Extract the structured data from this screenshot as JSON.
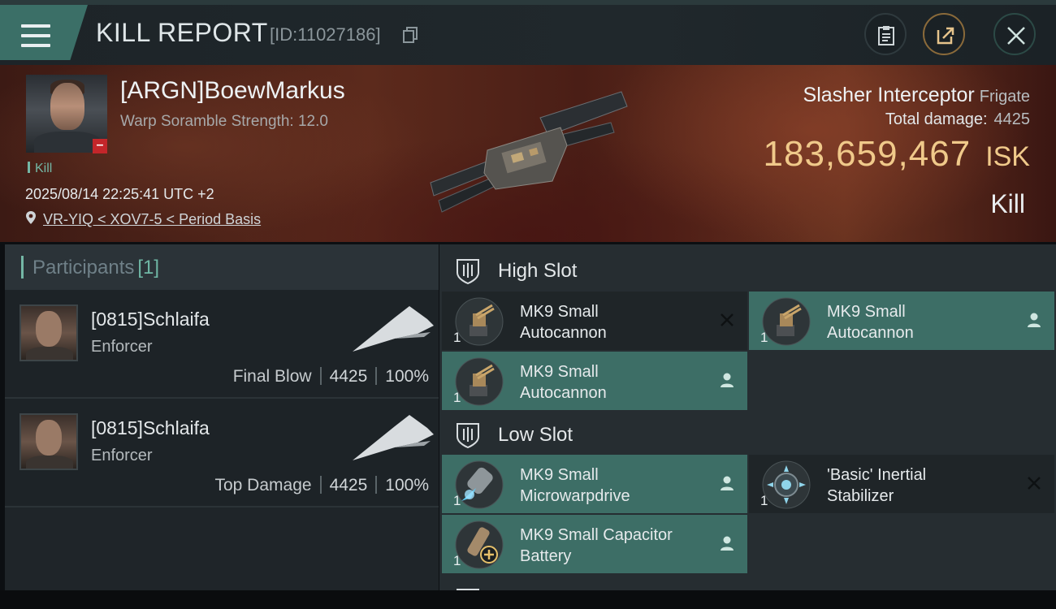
{
  "header": {
    "title": "KILL REPORT",
    "id_text": "[ID:11027186]"
  },
  "victim": {
    "name": "[ARGN]BoewMarkus",
    "warp_scramble": "Warp Soramble Strength: 12.0",
    "tag": "Kill",
    "datetime": "2025/08/14 22:25:41 UTC +2",
    "location": "VR-YIQ < XOV7-5 < Period Basis"
  },
  "ship": {
    "name": "Slasher Interceptor",
    "class": "Frigate",
    "damage_label": "Total damage:",
    "damage_value": "4425",
    "isk_value": "183,659,467",
    "isk_unit": "ISK",
    "result": "Kill"
  },
  "participants": {
    "title": "Participants",
    "count": "[1]",
    "rows": [
      {
        "name": "[0815]Schlaifa",
        "ship": "Enforcer",
        "label": "Final Blow",
        "damage": "4425",
        "percent": "100%"
      },
      {
        "name": "[0815]Schlaifa",
        "ship": "Enforcer",
        "label": "Top Damage",
        "damage": "4425",
        "percent": "100%"
      }
    ]
  },
  "slots": {
    "high": {
      "title": "High Slot",
      "modules": [
        {
          "qty": "1",
          "line1": "MK9 Small",
          "line2": "Autocannon",
          "state": "destroyed"
        },
        {
          "qty": "1",
          "line1": "MK9 Small",
          "line2": "Autocannon",
          "state": "dropped"
        },
        {
          "qty": "1",
          "line1": "MK9 Small",
          "line2": "Autocannon",
          "state": "dropped"
        }
      ]
    },
    "low": {
      "title": "Low Slot",
      "modules": [
        {
          "qty": "1",
          "line1": "MK9 Small",
          "line2": "Microwarpdrive",
          "state": "dropped"
        },
        {
          "qty": "1",
          "line1": "'Basic' Inertial",
          "line2": "Stabilizer",
          "state": "destroyed"
        },
        {
          "qty": "1",
          "line1": "MK9 Small Capacitor",
          "line2": "Battery",
          "state": "dropped"
        }
      ]
    }
  },
  "colors": {
    "accent_teal": "#74b7a5",
    "dropped_bg": "#3d6e66",
    "isk_gold": "#f0c98a",
    "alert_red": "#c3262a"
  }
}
